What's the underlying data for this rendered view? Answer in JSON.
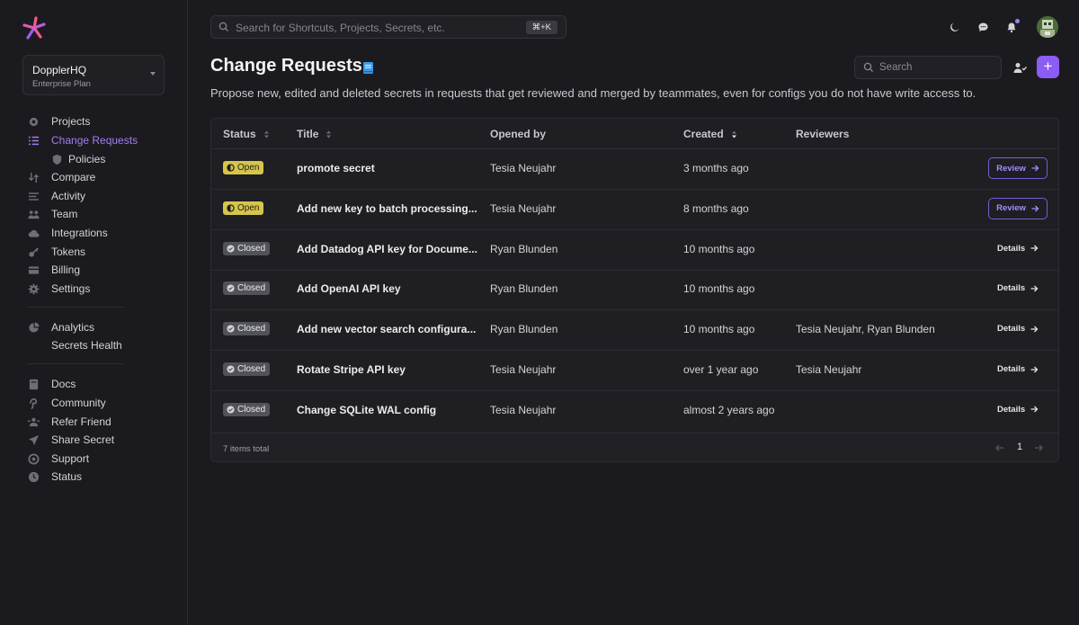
{
  "workspace": {
    "name": "DopplerHQ",
    "plan": "Enterprise Plan"
  },
  "top_search": {
    "placeholder": "Search for Shortcuts, Projects, Secrets, etc.",
    "shortcut": "⌘+K"
  },
  "sidebar": {
    "groups": [
      [
        {
          "label": "Projects",
          "icon": "projects-icon"
        },
        {
          "label": "Change Requests",
          "icon": "change-requests-icon",
          "active": true
        },
        {
          "label": "Policies",
          "icon": "shield-icon",
          "sub": true
        },
        {
          "label": "Compare",
          "icon": "compare-icon"
        },
        {
          "label": "Activity",
          "icon": "activity-icon"
        },
        {
          "label": "Team",
          "icon": "team-icon"
        },
        {
          "label": "Integrations",
          "icon": "cloud-icon"
        },
        {
          "label": "Tokens",
          "icon": "key-icon"
        },
        {
          "label": "Billing",
          "icon": "billing-icon"
        },
        {
          "label": "Settings",
          "icon": "gear-icon"
        }
      ],
      [
        {
          "label": "Analytics",
          "icon": "pie-chart-icon"
        },
        {
          "label": "Secrets Health",
          "icon": ""
        }
      ],
      [
        {
          "label": "Docs",
          "icon": "book-icon"
        },
        {
          "label": "Community",
          "icon": "community-icon"
        },
        {
          "label": "Refer Friend",
          "icon": "refer-icon"
        },
        {
          "label": "Share Secret",
          "icon": "send-icon"
        },
        {
          "label": "Support",
          "icon": "support-icon"
        },
        {
          "label": "Status",
          "icon": "status-icon"
        }
      ]
    ]
  },
  "page": {
    "title": "Change Requests",
    "description": "Propose new, edited and deleted secrets in requests that get reviewed and merged by teammates, even for configs you do not have write access to.",
    "search_placeholder": "Search"
  },
  "table": {
    "columns": {
      "status": "Status",
      "title": "Title",
      "opened_by": "Opened by",
      "created": "Created",
      "reviewers": "Reviewers"
    },
    "rows": [
      {
        "status": "Open",
        "title": "promote secret",
        "opened_by": "Tesia Neujahr",
        "created": "3 months ago",
        "reviewers": "",
        "action": "Review"
      },
      {
        "status": "Open",
        "title": "Add new key to batch processing...",
        "opened_by": "Tesia Neujahr",
        "created": "8 months ago",
        "reviewers": "",
        "action": "Review"
      },
      {
        "status": "Closed",
        "title": "Add Datadog API key for Docume...",
        "opened_by": "Ryan Blunden",
        "created": "10 months ago",
        "reviewers": "",
        "action": "Details"
      },
      {
        "status": "Closed",
        "title": "Add OpenAI API key",
        "opened_by": "Ryan Blunden",
        "created": "10 months ago",
        "reviewers": "",
        "action": "Details"
      },
      {
        "status": "Closed",
        "title": "Add new vector search configura...",
        "opened_by": "Ryan Blunden",
        "created": "10 months ago",
        "reviewers": "Tesia Neujahr, Ryan Blunden",
        "action": "Details"
      },
      {
        "status": "Closed",
        "title": "Rotate Stripe API key",
        "opened_by": "Tesia Neujahr",
        "created": "over 1 year ago",
        "reviewers": "Tesia Neujahr",
        "action": "Details"
      },
      {
        "status": "Closed",
        "title": "Change SQLite WAL config",
        "opened_by": "Tesia Neujahr",
        "created": "almost 2 years ago",
        "reviewers": "",
        "action": "Details"
      }
    ],
    "footer": {
      "total": "7 items total",
      "page": "1"
    }
  },
  "colors": {
    "accent": "#8b5cf6",
    "open_badge": "#d7c54a",
    "closed_badge": "#52525a"
  }
}
